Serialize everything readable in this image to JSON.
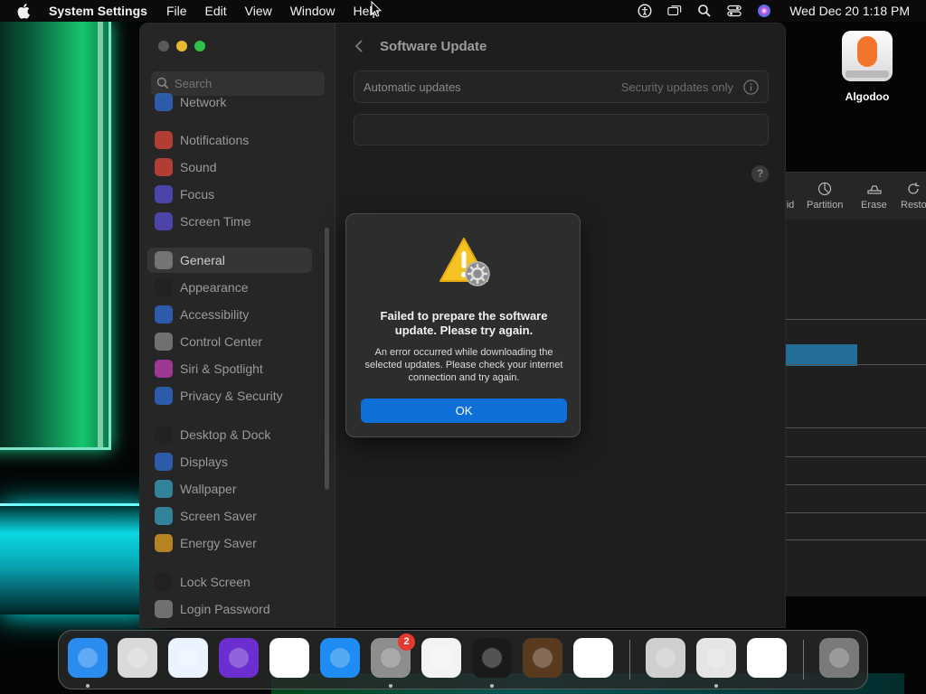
{
  "menubar": {
    "app_name": "System Settings",
    "menus": [
      "File",
      "Edit",
      "View",
      "Window",
      "Help"
    ],
    "clock": "Wed Dec 20  1:18 PM"
  },
  "desktop": {
    "icon_label": "Algodoo"
  },
  "disk_utility": {
    "tools": [
      "id",
      "Partition",
      "Erase",
      "Resto"
    ]
  },
  "settings": {
    "search_placeholder": "Search",
    "sidebar": [
      {
        "label": "Network",
        "icon": "globe-icon",
        "color": "#2f6fd6"
      },
      {
        "label": "Notifications",
        "icon": "bell-icon",
        "color": "#e0453a"
      },
      {
        "label": "Sound",
        "icon": "speaker-icon",
        "color": "#e0453a"
      },
      {
        "label": "Focus",
        "icon": "moon-icon",
        "color": "#5b4fd6"
      },
      {
        "label": "Screen Time",
        "icon": "hourglass-icon",
        "color": "#5b4fd6"
      },
      {
        "label": "General",
        "icon": "gear-icon",
        "color": "#8a8a8a"
      },
      {
        "label": "Appearance",
        "icon": "appearance-icon",
        "color": "#222222"
      },
      {
        "label": "Accessibility",
        "icon": "accessibility-icon",
        "color": "#2f6fd6"
      },
      {
        "label": "Control Center",
        "icon": "control-center-icon",
        "color": "#8a8a8a"
      },
      {
        "label": "Siri & Spotlight",
        "icon": "siri-icon",
        "color": "#c43fb6"
      },
      {
        "label": "Privacy & Security",
        "icon": "hand-icon",
        "color": "#2f6fd6"
      },
      {
        "label": "Desktop & Dock",
        "icon": "dock-icon",
        "color": "#222222"
      },
      {
        "label": "Displays",
        "icon": "sun-icon",
        "color": "#2f6fd6"
      },
      {
        "label": "Wallpaper",
        "icon": "flower-icon",
        "color": "#38a3c4"
      },
      {
        "label": "Screen Saver",
        "icon": "screensaver-icon",
        "color": "#38a3c4"
      },
      {
        "label": "Energy Saver",
        "icon": "bulb-icon",
        "color": "#e5a321"
      },
      {
        "label": "Lock Screen",
        "icon": "lock-icon",
        "color": "#222222"
      },
      {
        "label": "Login Password",
        "icon": "lock-icon",
        "color": "#8a8a8a"
      }
    ],
    "page_title": "Software Update",
    "automatic_updates_label": "Automatic updates",
    "automatic_updates_value": "Security updates only",
    "help_glyph": "?"
  },
  "alert": {
    "title": "Failed to prepare the software update. Please try again.",
    "message": "An error occurred while downloading the selected updates. Please check your internet connection and try again.",
    "ok_label": "OK"
  },
  "dock": {
    "apps": [
      {
        "name": "finder",
        "color": "#2b8cf0",
        "running": true
      },
      {
        "name": "launchpad",
        "color": "#d9d9d9",
        "running": false
      },
      {
        "name": "safari",
        "color": "#eaf3ff",
        "running": false
      },
      {
        "name": "firefox",
        "color": "#6b2fd0",
        "running": false
      },
      {
        "name": "chrome",
        "color": "#ffffff",
        "running": false
      },
      {
        "name": "app-store",
        "color": "#1e8cf2",
        "running": false
      },
      {
        "name": "system-settings",
        "color": "#8e8e8e",
        "running": true
      },
      {
        "name": "textedit",
        "color": "#f3f3f3",
        "running": false
      },
      {
        "name": "terminal",
        "color": "#1a1a1a",
        "running": true
      },
      {
        "name": "garageband",
        "color": "#5a3a1f",
        "running": false
      },
      {
        "name": "vscode",
        "color": "#ffffff",
        "running": false
      },
      {
        "name": "boot-camp",
        "color": "#cfcfcf",
        "running": false
      },
      {
        "name": "disk-utility",
        "color": "#e5e5e5",
        "running": true
      },
      {
        "name": "capcut",
        "color": "#ffffff",
        "running": false
      },
      {
        "name": "trash",
        "color": "#7a7a7a",
        "running": false
      }
    ],
    "badge_count": "2"
  }
}
